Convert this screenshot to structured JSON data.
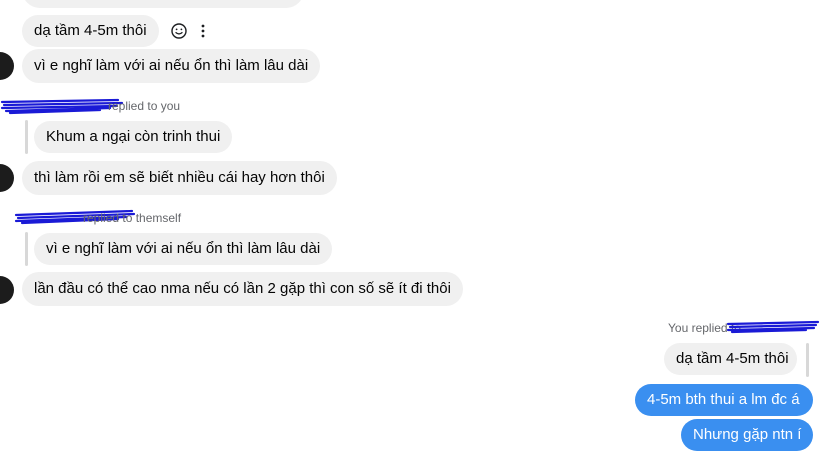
{
  "top_partial_bubble": "",
  "messages": [
    {
      "text": "dạ tầm 4-5m thôi"
    },
    {
      "text": "vì e nghĩ làm với ai nếu ổn thì làm lâu dài"
    },
    {
      "reply_meta": "replied to you",
      "reply_quote": "Khum a ngại còn trinh thui"
    },
    {
      "text": "thì làm rồi em sẽ biết nhiều cái hay hơn thôi"
    },
    {
      "reply_meta": "replied to themself",
      "reply_quote": "vì e nghĩ làm với ai nếu ổn thì làm lâu dài"
    },
    {
      "text": "lần đầu có thể cao nma nếu có lần 2 gặp thì con số sẽ ít đi thôi"
    },
    {
      "reply_meta": "You replied to",
      "reply_quote": "dạ tầm 4-5m thôi"
    },
    {
      "text": "4-5m bth thui a lm đc á"
    },
    {
      "text": "Nhưng gặp ntn í"
    }
  ],
  "icons": {
    "react": "smiley-icon",
    "more": "more-vertical-icon"
  },
  "colors": {
    "incoming_bubble": "#f0f0f0",
    "outgoing_bubble": "#3a8ff0",
    "scribble": "#1a1ad6"
  }
}
